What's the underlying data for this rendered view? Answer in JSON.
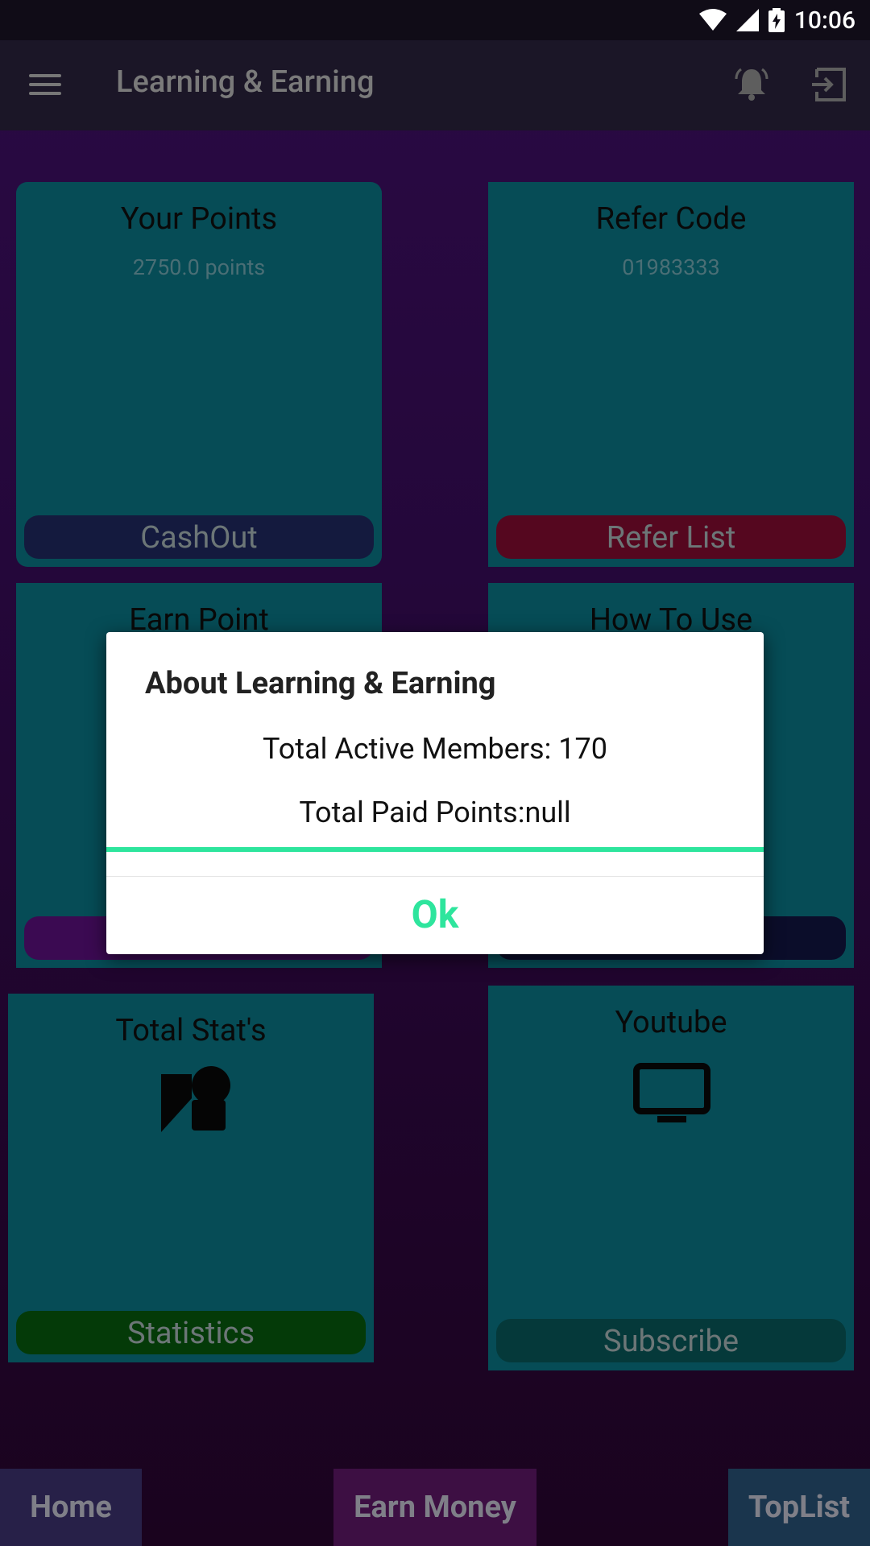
{
  "status_bar": {
    "time": "10:06"
  },
  "app_bar": {
    "title": "Learning & Earning"
  },
  "cards": {
    "points": {
      "title": "Your Points",
      "value": "2750.0 points",
      "button": "CashOut"
    },
    "refer": {
      "title": "Refer Code",
      "value": "01983333",
      "button": "Refer List"
    },
    "earn": {
      "title": "Earn Point"
    },
    "howto": {
      "title": "How To Use"
    },
    "stats": {
      "title": "Total Stat's",
      "button": "Statistics",
      "icon": "shapes-icon"
    },
    "youtube": {
      "title": "Youtube",
      "button": "Subscribe",
      "icon": "tv-icon"
    }
  },
  "dialog": {
    "title": "About Learning & Earning",
    "line1": "Total Active Members: 170",
    "line2": "Total Paid Points:null",
    "ok_label": "Ok"
  },
  "bottom_nav": {
    "home": "Home",
    "earn": "Earn Money",
    "toplist": "TopList"
  },
  "colors": {
    "accent": "#2ee59d",
    "card": "#064c56",
    "cashout": "#141a3e",
    "refer_list": "#55071f",
    "statistics": "#043a08",
    "subscribe": "#05393a"
  }
}
